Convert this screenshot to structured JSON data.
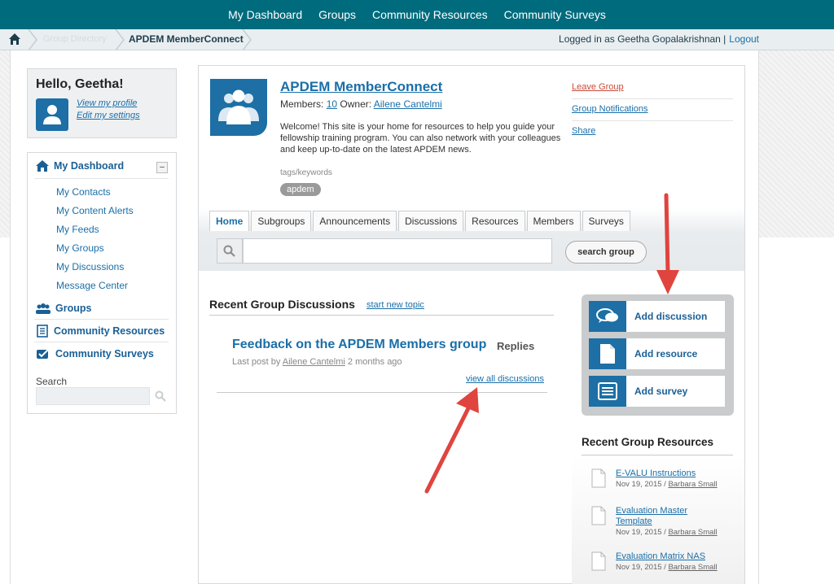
{
  "topnav": {
    "items": [
      "My Dashboard",
      "Groups",
      "Community Resources",
      "Community Surveys"
    ]
  },
  "breadcrumb": {
    "directory": "Group Directory",
    "current": "APDEM MemberConnect"
  },
  "session": {
    "logged_in_text": "Logged in as Geetha Gopalakrishnan |",
    "logout": "Logout"
  },
  "hello": {
    "greeting": "Hello, Geetha!",
    "view_profile": "View my profile",
    "edit_settings": "Edit my settings"
  },
  "leftnav": {
    "dashboard": "My Dashboard",
    "collapse": "–",
    "sub_items": [
      "My Contacts",
      "My Content Alerts",
      "My Feeds",
      "My Groups",
      "My Discussions",
      "Message Center"
    ],
    "groups": "Groups",
    "resources": "Community Resources",
    "surveys": "Community Surveys",
    "search_label": "Search"
  },
  "group": {
    "title": "APDEM MemberConnect",
    "members_label": "Members:",
    "members_count": "10",
    "owner_label": "Owner:",
    "owner": "Ailene Cantelmi",
    "description": "Welcome! This site is your home for resources to help you guide your fellowship training program. You can also network with your colleagues and keep up-to-date on the latest APDEM news.",
    "tags_label": "tags/keywords",
    "tag": "apdem",
    "actions": {
      "leave": "Leave Group",
      "notifications": "Group Notifications",
      "share": "Share"
    }
  },
  "tabs": [
    "Home",
    "Subgroups",
    "Announcements",
    "Discussions",
    "Resources",
    "Members",
    "Surveys"
  ],
  "group_search": {
    "button": "search group",
    "placeholder": ""
  },
  "discussions": {
    "title": "Recent Group Discussions",
    "new_topic": "start new topic",
    "item": {
      "title": "Feedback on the APDEM Members group",
      "replies": "Replies",
      "last_post_label": "Last post by",
      "author": "Ailene Cantelmi",
      "ago": "2 months ago"
    },
    "view_all": "view all discussions"
  },
  "add_actions": {
    "discussion": "Add discussion",
    "resource": "Add resource",
    "survey": "Add survey"
  },
  "resources": {
    "title": "Recent Group Resources",
    "items": [
      {
        "name": "E-VALU Instructions",
        "date": "Nov 19, 2015 /",
        "author": "Barbara Small"
      },
      {
        "name": "Evaluation Master Template",
        "date": "Nov 19, 2015 /",
        "author": "Barbara Small"
      },
      {
        "name": "Evaluation Matrix NAS",
        "date": "Nov 19, 2015 /",
        "author": "Barbara Small"
      }
    ]
  },
  "colors": {
    "nav_teal": "#006b7d",
    "brand_blue": "#1d6fa5",
    "arrow_red": "#e0443e"
  }
}
